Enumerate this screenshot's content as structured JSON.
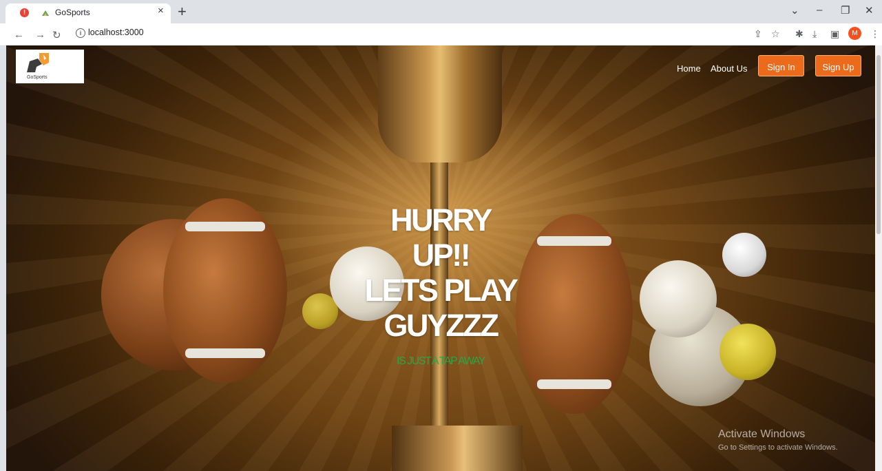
{
  "browser": {
    "tab_title": "GoSports",
    "tab_close": "×",
    "new_tab": "+",
    "url": "localhost:3000",
    "profile_initial": "M",
    "error_badge": "!"
  },
  "site": {
    "logo_text": "GoSports",
    "nav": {
      "home": "Home",
      "about": "About Us"
    },
    "buttons": {
      "sign_in": "Sign In",
      "sign_up": "Sign Up"
    },
    "accent_color": "#ec6a1c"
  },
  "hero": {
    "lines": [
      "HURRY",
      "UP!!",
      "LETS PLAY",
      "GUYZZZ"
    ],
    "tagline": "IS JUST A TAP AWAY",
    "tagline_color": "#28a745"
  },
  "watermark": {
    "title": "Activate Windows",
    "subtitle": "Go to Settings to activate Windows."
  }
}
